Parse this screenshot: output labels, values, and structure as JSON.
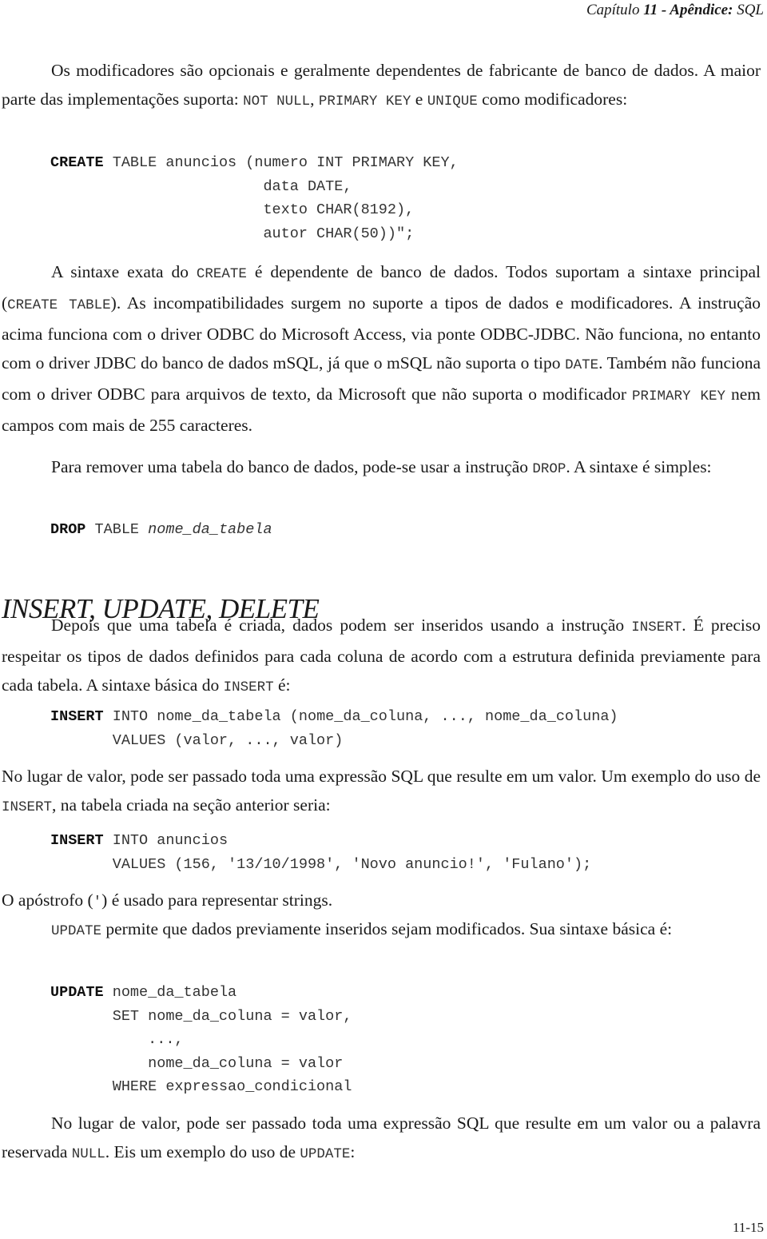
{
  "header": {
    "chapter_prefix": "Capítulo",
    "chapter_number": "11",
    "chapter_sep": " - Apêndice:",
    "chapter_topic": "SQL"
  },
  "para1": {
    "t1": "Os modificadores são opcionais e geralmente dependentes de fabricante de banco de dados. A maior parte das implementações suporta: ",
    "c1": "NOT NULL",
    "t2": ", ",
    "c2": "PRIMARY KEY",
    "t3": " e ",
    "c3": "UNIQUE",
    "t4": " como modificadores:"
  },
  "code_create": {
    "kw": "CREATE",
    "line1": " TABLE anuncios (numero INT PRIMARY KEY,",
    "line2": "                        data DATE,",
    "line3": "                        texto CHAR(8192),",
    "line4": "                        autor CHAR(50))\";"
  },
  "para2": {
    "t1": "A sintaxe exata do ",
    "c1": "CREATE",
    "t2": " é dependente de banco de dados. Todos suportam a sintaxe principal (",
    "c2": "CREATE TABLE",
    "t3": "). As incompatibilidades surgem no suporte a tipos de dados e modificadores. A instrução acima funciona com o driver ODBC do Microsoft Access, via ponte ODBC-JDBC. Não funciona, no entanto com o driver JDBC do banco de dados mSQL, já que o mSQL não suporta o tipo ",
    "c3": "DATE",
    "t4": ". Também não funciona com o driver ODBC para arquivos de texto, da Microsoft que não suporta o modificador ",
    "c4": "PRIMARY KEY",
    "t5": " nem campos com mais de 255 caracteres."
  },
  "para3": {
    "t1": "Para remover uma tabela do banco de dados, pode-se usar a instrução ",
    "c1": "DROP",
    "t2": ". A sintaxe é simples:"
  },
  "code_drop": {
    "kw": "DROP",
    "mid": " TABLE ",
    "arg": "nome_da_tabela"
  },
  "section_heading": "INSERT, UPDATE, DELETE",
  "para4": {
    "t1": "Depois que uma tabela é criada, dados podem ser inseridos usando a instrução ",
    "c1": "INSERT",
    "t2": ". É preciso respeitar os tipos de dados definidos para cada coluna de acordo com a estrutura definida previamente para cada tabela. A sintaxe básica do ",
    "c2": "INSERT",
    "t3": " é:"
  },
  "code_insert_syntax": {
    "kw": "INSERT",
    "line1": " INTO nome_da_tabela (nome_da_coluna, ..., nome_da_coluna)",
    "line2": "       VALUES (valor, ..., valor)"
  },
  "para5": {
    "t1": "No lugar de  valor, pode ser passado toda uma expressão SQL que resulte em um valor. Um exemplo do uso de ",
    "c1": "INSERT",
    "t2": ", na tabela criada na seção anterior seria:"
  },
  "code_insert_example": {
    "kw": "INSERT",
    "line1": " INTO anuncios",
    "line2": "       VALUES (156, '13/10/1998', 'Novo anuncio!', 'Fulano');"
  },
  "para6": {
    "t1": "O apóstrofo (",
    "c1": "'",
    "t2": ") é usado para representar strings."
  },
  "para7": {
    "c1": "UPDATE",
    "t1": " permite que dados previamente inseridos sejam modificados. Sua sintaxe básica é:"
  },
  "code_update": {
    "kw": "UPDATE",
    "line1": " nome_da_tabela",
    "line2": "       SET nome_da_coluna = valor,",
    "line3": "           ...,",
    "line4": "           nome_da_coluna = valor",
    "line5": "       WHERE expressao_condicional"
  },
  "para8": {
    "t1": "No lugar de valor, pode ser passado toda uma expressão SQL que resulte em um valor ou a palavra reservada ",
    "c1": "NULL",
    "t2": ". Eis um exemplo do uso de ",
    "c2": "UPDATE",
    "t3": ":"
  },
  "page_number": "11-15"
}
